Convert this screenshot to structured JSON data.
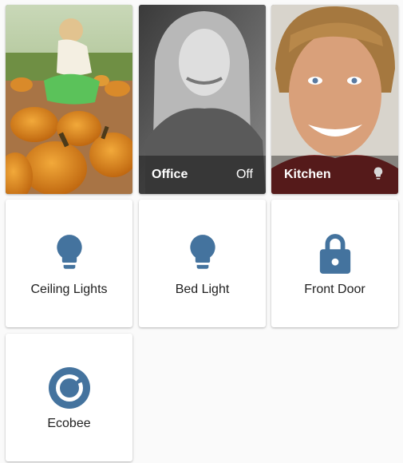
{
  "colors": {
    "icon_active": "#44739e",
    "page_background": "#fafafa",
    "card_background": "#ffffff",
    "label_text": "#212121"
  },
  "cards": {
    "pumpkin_photo": {
      "image": "pumpkin-field-photo"
    },
    "office": {
      "name": "Office",
      "state": "Off",
      "image": "woman-portrait-photo-grayscale"
    },
    "kitchen": {
      "name": "Kitchen",
      "state_icon": "lightbulb-icon",
      "image": "smiling-man-portrait-photo"
    },
    "ceiling_lights": {
      "label": "Ceiling Lights",
      "icon": "lightbulb-icon"
    },
    "bed_light": {
      "label": "Bed Light",
      "icon": "lightbulb-icon"
    },
    "front_door": {
      "label": "Front Door",
      "icon": "lock-icon"
    },
    "ecobee": {
      "label": "Ecobee",
      "icon": "thermostat-icon"
    }
  }
}
